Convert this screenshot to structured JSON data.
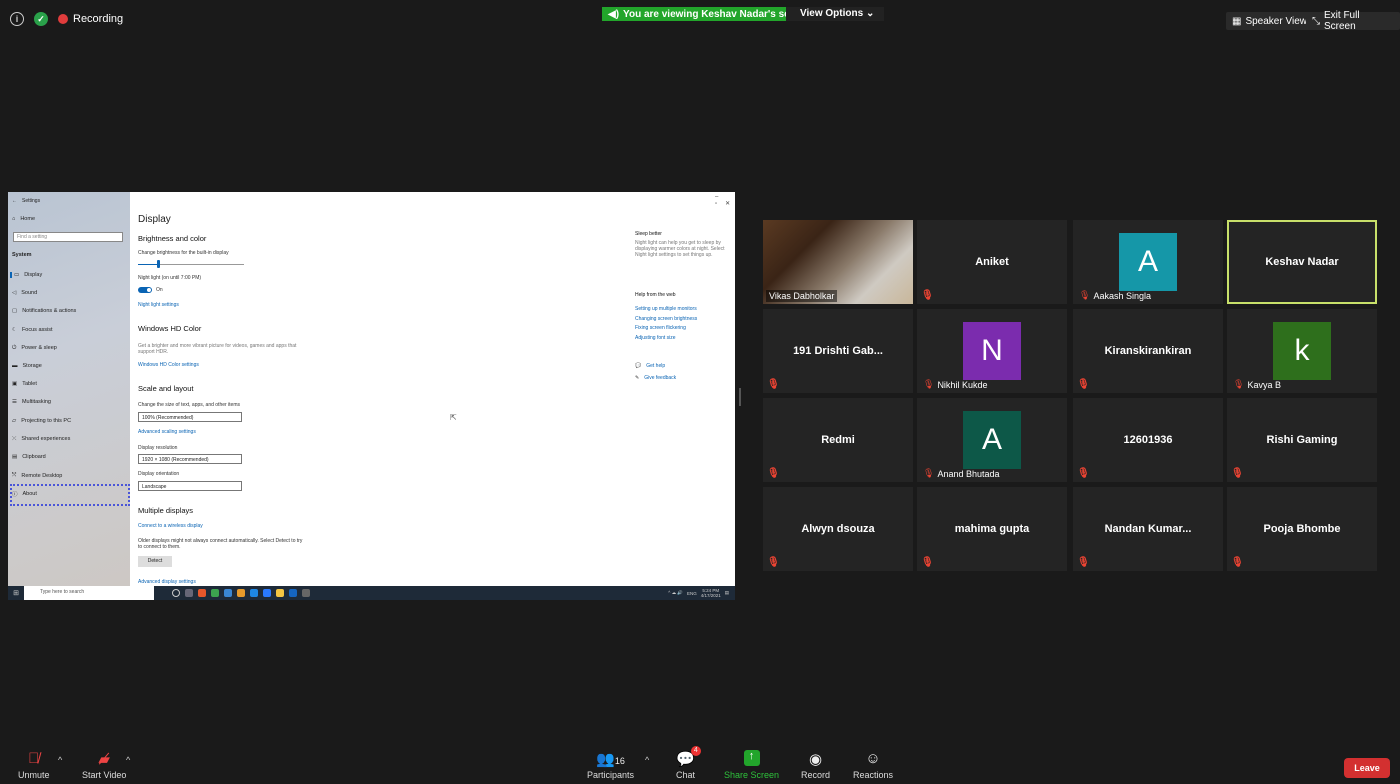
{
  "top": {
    "recording_label": "Recording",
    "viewing_banner": "You are viewing Keshav Nadar's screen",
    "view_options": "View Options ⌄",
    "speaker_view": "Speaker View",
    "exit_full_screen": "Exit Full Screen"
  },
  "shared": {
    "window_title": "Settings",
    "side": {
      "home": "Home",
      "search_placeholder": "Find a setting",
      "section": "System",
      "items": [
        "Display",
        "Sound",
        "Notifications & actions",
        "Focus assist",
        "Power & sleep",
        "Storage",
        "Tablet",
        "Multitasking",
        "Projecting to this PC",
        "Shared experiences",
        "Clipboard",
        "Remote Desktop",
        "About"
      ]
    },
    "main": {
      "title": "Display",
      "brightness_header": "Brightness and color",
      "brightness_label": "Change brightness for the built-in display",
      "night_light_label": "Night light (on until 7:00 PM)",
      "toggle_state": "On",
      "night_light_settings": "Night light settings",
      "hd_header": "Windows HD Color",
      "hd_desc": "Get a brighter and more vibrant picture for videos, games and apps that support HDR.",
      "hd_link": "Windows HD Color settings",
      "scale_header": "Scale and layout",
      "scale_label": "Change the size of text, apps, and other items",
      "scale_value": "100% (Recommended)",
      "adv_scaling": "Advanced scaling settings",
      "res_label": "Display resolution",
      "res_value": "1920 × 1080 (Recommended)",
      "orient_label": "Display orientation",
      "orient_value": "Landscape",
      "multi_header": "Multiple displays",
      "wireless_link": "Connect to a wireless display",
      "multi_desc": "Older displays might not always connect automatically. Select Detect to try to connect to them.",
      "detect_btn": "Detect",
      "adv_display": "Advanced display settings"
    },
    "right": {
      "sleep_header": "Sleep better",
      "sleep_desc": "Night light can help you get to sleep by displaying warmer colors at night. Select Night light settings to set things up.",
      "help_header": "Help from the web",
      "links": [
        "Setting up multiple monitors",
        "Changing screen brightness",
        "Fixing screen flickering",
        "Adjusting font size"
      ],
      "get_help": "Get help",
      "feedback": "Give feedback"
    },
    "taskbar": {
      "search": "Type here to search",
      "lang": "ENG",
      "time": "5:24 PM",
      "date": "4/17/2021"
    }
  },
  "participants": [
    {
      "name": "Vikas Dabholkar",
      "type": "video"
    },
    {
      "name": "Aniket",
      "type": "text"
    },
    {
      "name": "Aakash Singla",
      "type": "avatar",
      "letter": "A",
      "color": "#1597a8"
    },
    {
      "name": "Keshav Nadar",
      "type": "text",
      "active": true
    },
    {
      "name": "191 Drishti Gab...",
      "type": "text"
    },
    {
      "name": "Nikhil Kukde",
      "type": "avatar",
      "letter": "N",
      "color": "#7b2cae"
    },
    {
      "name": "Kiranskirankiran",
      "type": "text"
    },
    {
      "name": "Kavya B",
      "type": "avatar",
      "letter": "k",
      "color": "#2e6f1c"
    },
    {
      "name": "Redmi",
      "type": "text"
    },
    {
      "name": "Anand Bhutada",
      "type": "avatar",
      "letter": "A",
      "color": "#0d5848"
    },
    {
      "name": "12601936",
      "type": "text"
    },
    {
      "name": "Rishi Gaming",
      "type": "text"
    },
    {
      "name": "Alwyn dsouza",
      "type": "text"
    },
    {
      "name": "mahima gupta",
      "type": "text"
    },
    {
      "name": "Nandan  Kumar...",
      "type": "text"
    },
    {
      "name": "Pooja Bhombe",
      "type": "text"
    }
  ],
  "bottom": {
    "unmute": "Unmute",
    "start_video": "Start Video",
    "participants": "Participants",
    "participant_count": "16",
    "chat": "Chat",
    "chat_badge": "4",
    "share_screen": "Share Screen",
    "record": "Record",
    "reactions": "Reactions",
    "leave": "Leave"
  },
  "colors": {
    "share_green": "#22a52b",
    "leave_red": "#d33030",
    "active_border": "#c8e06a"
  }
}
